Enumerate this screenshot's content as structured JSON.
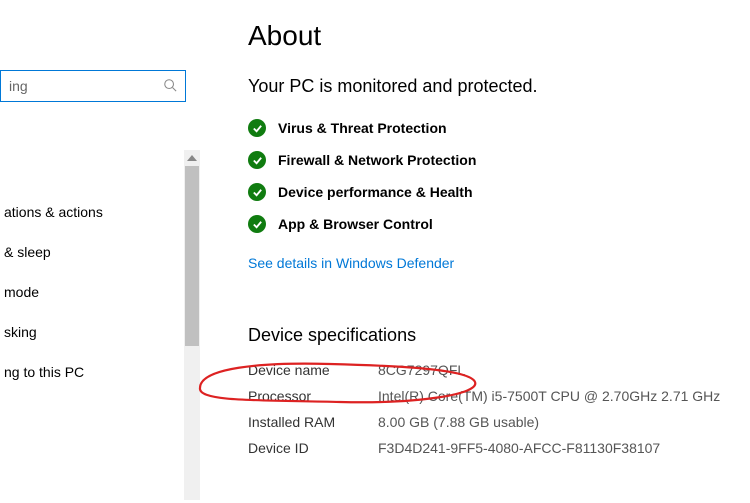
{
  "search": {
    "placeholder": "ing",
    "value": "ing"
  },
  "sidebar": {
    "items": [
      {
        "label": "ations & actions"
      },
      {
        "label": "& sleep"
      },
      {
        "label": "mode"
      },
      {
        "label": "sking"
      },
      {
        "label": "ng to this PC"
      }
    ]
  },
  "main": {
    "title": "About",
    "status": "Your PC is monitored and protected.",
    "protections": [
      {
        "label": "Virus & Threat Protection"
      },
      {
        "label": "Firewall & Network Protection"
      },
      {
        "label": "Device performance & Health"
      },
      {
        "label": "App & Browser Control"
      }
    ],
    "defender_link": "See details in Windows Defender",
    "specs_title": "Device specifications",
    "specs": [
      {
        "label": "Device name",
        "value": "8CG7297QFL"
      },
      {
        "label": "Processor",
        "value": "Intel(R) Core(TM) i5-7500T CPU @ 2.70GHz   2.71 GHz"
      },
      {
        "label": "Installed RAM",
        "value": "8.00 GB (7.88 GB usable)"
      },
      {
        "label": "Device ID",
        "value": "F3D4D241-9FF5-4080-AFCC-F81130F38107"
      }
    ]
  }
}
